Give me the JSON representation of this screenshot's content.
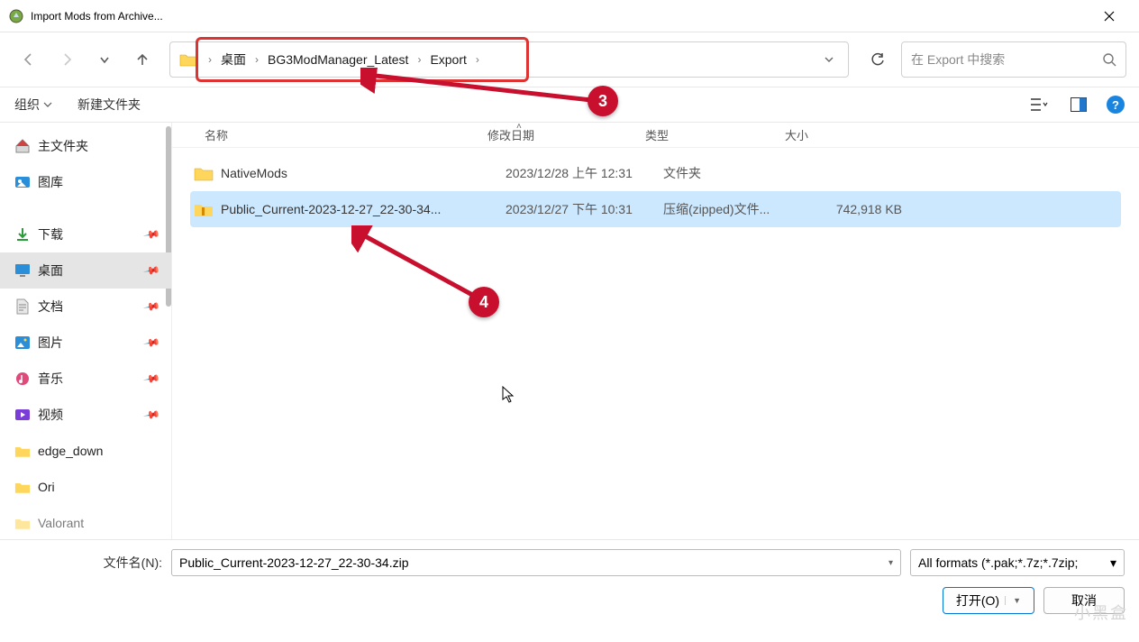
{
  "window": {
    "title": "Import Mods from Archive..."
  },
  "breadcrumb": {
    "items": [
      "桌面",
      "BG3ModManager_Latest",
      "Export"
    ]
  },
  "search": {
    "placeholder": "在 Export 中搜索"
  },
  "toolbar": {
    "organize": "组织",
    "newfolder": "新建文件夹"
  },
  "sidebar": {
    "home": "主文件夹",
    "gallery": "图库",
    "downloads": "下载",
    "desktop": "桌面",
    "documents": "文档",
    "pictures": "图片",
    "music": "音乐",
    "videos": "视频",
    "edge": "edge_down",
    "ori": "Ori",
    "valorant": "Valorant"
  },
  "columns": {
    "name": "名称",
    "date": "修改日期",
    "type": "类型",
    "size": "大小"
  },
  "files": [
    {
      "name": "NativeMods",
      "date": "2023/12/28 上午 12:31",
      "type": "文件夹",
      "size": ""
    },
    {
      "name": "Public_Current-2023-12-27_22-30-34...",
      "date": "2023/12/27 下午 10:31",
      "type": "压缩(zipped)文件...",
      "size": "742,918 KB"
    }
  ],
  "bottom": {
    "filename_label": "文件名(N):",
    "filename_value": "Public_Current-2023-12-27_22-30-34.zip",
    "filter": "All formats (*.pak;*.7z;*.7zip;",
    "open": "打开(O)",
    "cancel": "取消"
  },
  "annotations": {
    "c3": "3",
    "c4": "4"
  },
  "watermark": "小黑盒"
}
